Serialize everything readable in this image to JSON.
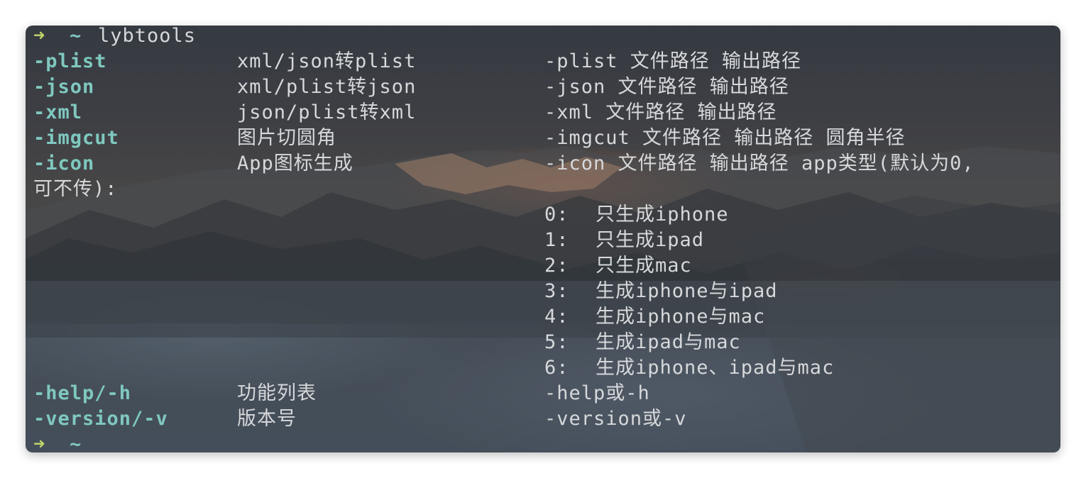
{
  "prompt": {
    "arrow": "➜",
    "dir": "~",
    "command": "lybtools"
  },
  "commands": [
    {
      "flag": "-plist",
      "desc": "xml/json转plist",
      "usage": "-plist 文件路径 输出路径"
    },
    {
      "flag": "-json",
      "desc": "xml/plist转json",
      "usage": "-json 文件路径 输出路径"
    },
    {
      "flag": "-xml",
      "desc": "json/plist转xml",
      "usage": "-xml 文件路径 输出路径"
    },
    {
      "flag": "-imgcut",
      "desc": "图片切圆角",
      "usage": "-imgcut 文件路径 输出路径 圆角半径"
    },
    {
      "flag": "-icon",
      "desc": "App图标生成",
      "usage": "-icon 文件路径 输出路径 app类型(默认为0,"
    }
  ],
  "icon_wrap": "可不传):",
  "icon_options": [
    {
      "num": "0:",
      "text": "只生成iphone"
    },
    {
      "num": "1:",
      "text": "只生成ipad"
    },
    {
      "num": "2:",
      "text": "只生成mac"
    },
    {
      "num": "3:",
      "text": "生成iphone与ipad"
    },
    {
      "num": "4:",
      "text": "生成iphone与mac"
    },
    {
      "num": "5:",
      "text": "生成ipad与mac"
    },
    {
      "num": "6:",
      "text": "生成iphone、ipad与mac"
    }
  ],
  "extra_commands": [
    {
      "flag": "-help/-h",
      "desc": "功能列表",
      "usage": "-help或-h"
    },
    {
      "flag": "-version/-v",
      "desc": "版本号",
      "usage": "-version或-v"
    }
  ],
  "prompt_end": {
    "arrow": "➜",
    "dir": "~"
  },
  "colors": {
    "flag": "#7fc8bf",
    "arrow": "#bfd36a",
    "text": "#d6d8da"
  }
}
